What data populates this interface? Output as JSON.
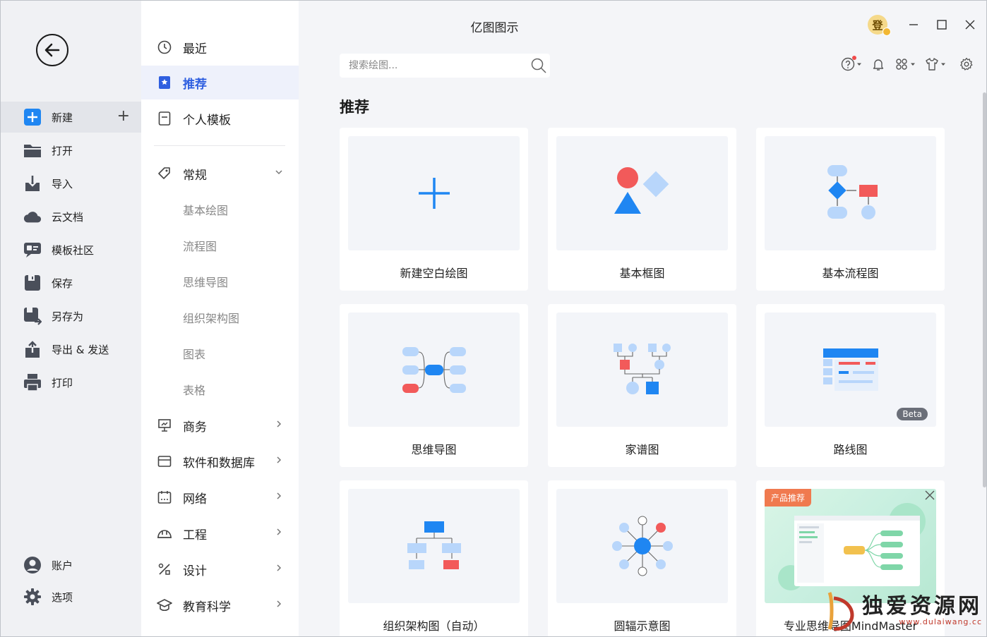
{
  "app": {
    "title": "亿图图示",
    "avatar_char": "登"
  },
  "left_menu": {
    "items": [
      {
        "label": "新建",
        "icon": "new-plus-icon",
        "color": "#1f86f2"
      },
      {
        "label": "打开",
        "icon": "folder-icon",
        "color": "#4a4f5a"
      },
      {
        "label": "导入",
        "icon": "import-icon",
        "color": "#4a4f5a"
      },
      {
        "label": "云文档",
        "icon": "cloud-icon",
        "color": "#4a4f5a"
      },
      {
        "label": "模板社区",
        "icon": "community-icon",
        "color": "#4a4f5a"
      },
      {
        "label": "保存",
        "icon": "save-icon",
        "color": "#4a4f5a"
      },
      {
        "label": "另存为",
        "icon": "save-as-icon",
        "color": "#4a4f5a"
      },
      {
        "label": "导出 & 发送",
        "icon": "export-icon",
        "color": "#4a4f5a"
      },
      {
        "label": "打印",
        "icon": "print-icon",
        "color": "#4a4f5a"
      }
    ],
    "bottom": [
      {
        "label": "账户",
        "icon": "account-icon"
      },
      {
        "label": "选项",
        "icon": "gear-icon"
      }
    ]
  },
  "categories": {
    "top": [
      {
        "label": "最近",
        "icon": "clock-icon"
      },
      {
        "label": "推荐",
        "icon": "bookmark-icon"
      },
      {
        "label": "个人模板",
        "icon": "document-icon"
      }
    ],
    "general": {
      "label": "常规",
      "icon": "tag-icon"
    },
    "sub": [
      "基本绘图",
      "流程图",
      "思维导图",
      "组织架构图",
      "图表",
      "表格"
    ],
    "groups": [
      {
        "label": "商务",
        "icon": "presentation-icon"
      },
      {
        "label": "软件和数据库",
        "icon": "window-icon"
      },
      {
        "label": "网络",
        "icon": "calendar-icon"
      },
      {
        "label": "工程",
        "icon": "helmet-icon"
      },
      {
        "label": "设计",
        "icon": "design-tools-icon"
      },
      {
        "label": "教育科学",
        "icon": "graduation-cap-icon"
      }
    ]
  },
  "search": {
    "placeholder": "搜索绘图..."
  },
  "section_title": "推荐",
  "cards": [
    {
      "label": "新建空白绘图"
    },
    {
      "label": "基本框图"
    },
    {
      "label": "基本流程图"
    },
    {
      "label": "思维导图"
    },
    {
      "label": "家谱图"
    },
    {
      "label": "路线图",
      "badge": "Beta"
    },
    {
      "label": "组织架构图（自动）"
    },
    {
      "label": "圆辐示意图"
    },
    {
      "label": "专业思维导图MindMaster",
      "tag": "产品推荐"
    }
  ],
  "watermark": {
    "text": "独爱资源网",
    "url": "www.dulaiwang.cc"
  },
  "colors": {
    "accent": "#2f5fe0",
    "blue": "#1f86f2",
    "light_blue": "#b8d6fb",
    "red": "#f25a5a"
  }
}
